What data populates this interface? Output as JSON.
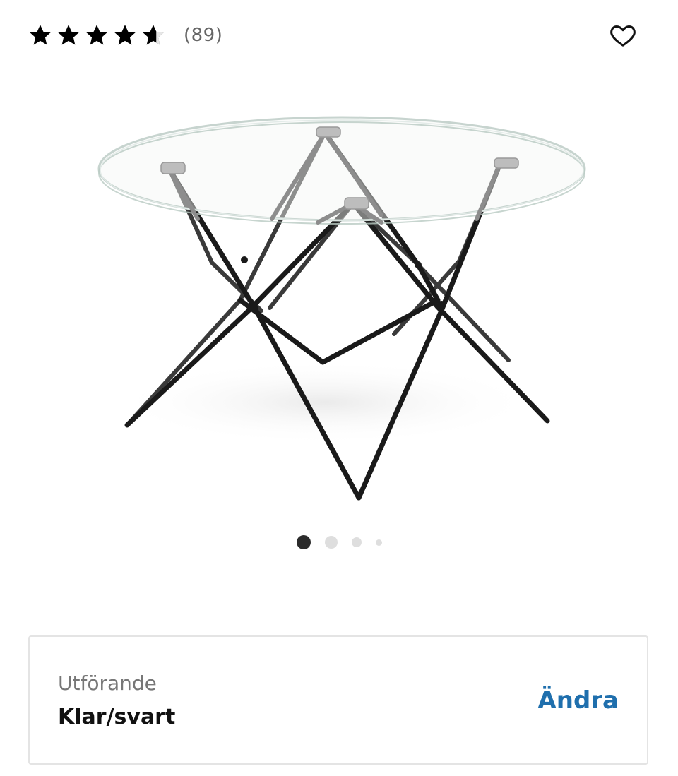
{
  "rating": {
    "value": 4.5,
    "max": 5,
    "review_count_text": "(89)",
    "star_icon": "star-icon",
    "half_star_icon": "star-half-icon"
  },
  "favorite": {
    "icon": "heart-outline-icon"
  },
  "product_image": {
    "subject": "round glass coffee table with black hairpin legs"
  },
  "carousel": {
    "total": 4,
    "active_index": 0
  },
  "variant": {
    "label": "Utförande",
    "value": "Klar/svart",
    "change_label": "Ändra"
  },
  "colors": {
    "accent": "#1f6fad",
    "dot_active": "#2b2b2b",
    "dot_inactive": "#dedede"
  }
}
